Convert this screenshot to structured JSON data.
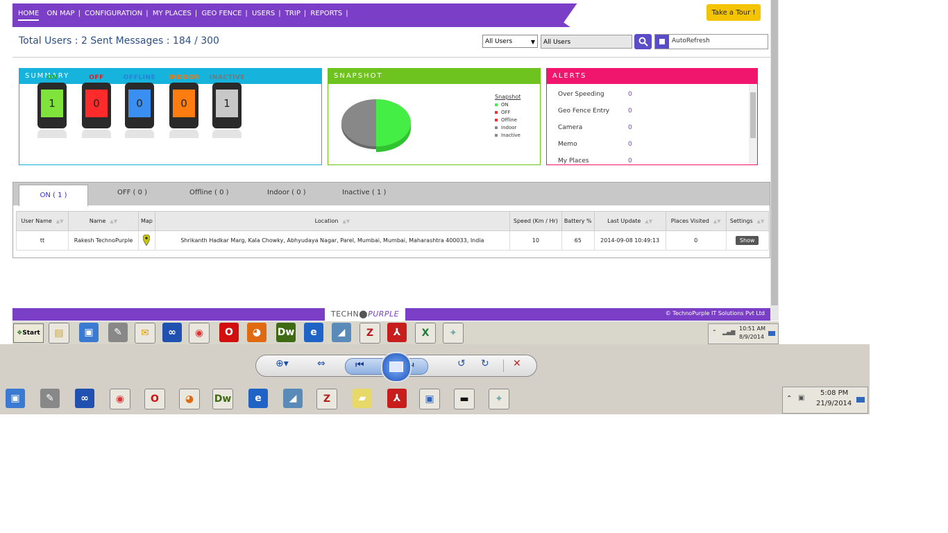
{
  "nav": {
    "items": [
      "HOME",
      "ON MAP",
      "CONFIGURATION",
      "MY PLACES",
      "GEO FENCE",
      "USERS",
      "TRIP",
      "REPORTS"
    ],
    "tour": "Take a Tour !"
  },
  "stats": {
    "total_text": "Total Users : 2 Sent Messages : 184 / 300"
  },
  "filters": {
    "select_value": "All Users",
    "input_value": "All Users",
    "autorefresh_label": "AutoRefresh"
  },
  "summary": {
    "title": "SUMMARY",
    "phones": [
      {
        "label": "ON",
        "value": "1",
        "color": "#2fa82f",
        "screen": "#7fe33c"
      },
      {
        "label": "OFF",
        "value": "0",
        "color": "#e02020",
        "screen": "#ff2a2a"
      },
      {
        "label": "OFFLINE",
        "value": "0",
        "color": "#2a80d8",
        "screen": "#3b8ff0"
      },
      {
        "label": "INDOOR",
        "value": "0",
        "color": "#f07810",
        "screen": "#ff7d10"
      },
      {
        "label": "INACTIVE",
        "value": "1",
        "color": "#777777",
        "screen": "#c8c8c8"
      }
    ]
  },
  "snapshot": {
    "title": "SNAPSHOT",
    "legend_title": "Snapshot",
    "legend": [
      {
        "label": "ON",
        "color": "#44ee44"
      },
      {
        "label": "OFF",
        "color": "#ee3333"
      },
      {
        "label": "Offline",
        "color": "#ee3333"
      },
      {
        "label": "Indoor",
        "color": "#888888"
      },
      {
        "label": "Inactive",
        "color": "#888888"
      }
    ]
  },
  "alerts": {
    "title": "ALERTS",
    "rows": [
      {
        "label": "Over Speeding",
        "value": "0"
      },
      {
        "label": "Geo Fence Entry",
        "value": "0"
      },
      {
        "label": "Camera",
        "value": "0"
      },
      {
        "label": "Memo",
        "value": "0"
      },
      {
        "label": "My Places",
        "value": "0"
      }
    ]
  },
  "tabs": [
    "ON ( 1 )",
    "OFF ( 0 )",
    "Offline ( 0 )",
    "Indoor ( 0 )",
    "Inactive ( 1 )"
  ],
  "table": {
    "headers": [
      "User Name",
      "Name",
      "Map",
      "Location",
      "Speed (Km / Hr)",
      "Battery %",
      "Last Update",
      "Places Visited",
      "Settings"
    ],
    "rows": [
      [
        "tt",
        "Rakesh TechnoPurple",
        "",
        "Shrikanth Hadkar Marg, Kala Chowky, Abhyudaya Nagar, Parel, Mumbai, Mumbai, Maharashtra 400033, India",
        "10",
        "65",
        "2014-09-08 10:49:13",
        "0",
        "Show"
      ]
    ]
  },
  "footer": {
    "logo_a": "TECHN",
    "logo_b": "PURPLE",
    "copyright": "© TechnoPurple IT Solutions Pvt Ltd"
  },
  "taskbar_inner": {
    "start": "Start",
    "time": "10:51 AM",
    "date": "8/9/2014"
  },
  "taskbar_outer": {
    "time": "5:08 PM",
    "date": "21/9/2014"
  }
}
